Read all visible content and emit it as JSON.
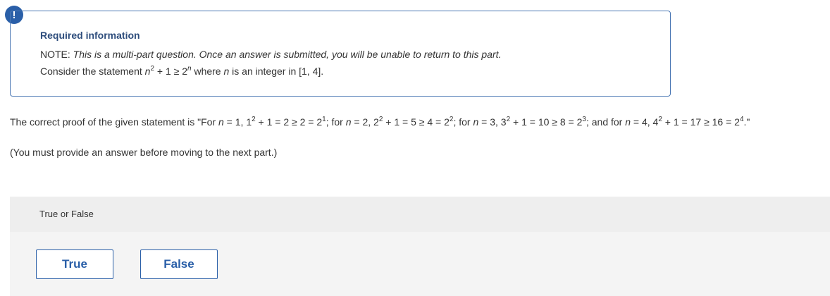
{
  "alert": {
    "glyph": "!"
  },
  "info": {
    "title": "Required information",
    "note_label": "NOTE:",
    "note_text": "This is a multi-part question. Once an answer is submitted, you will be unable to return to this part.",
    "consider_prefix": "Consider the statement",
    "n": "n",
    "exp_2": "2",
    "plus_one_geq_two": "+ 1 ≥ 2",
    "exp_n": "n",
    "where": "where",
    "consider_suffix": "is an integer in [1, 4]."
  },
  "proof": {
    "p0": "The correct proof of the given statement is \"For ",
    "n": "n",
    "s1": " = 1, 1",
    "e1": "2",
    "s2": " + 1 = 2 ≥ 2 = 2",
    "e2": "1",
    "s3": "; for ",
    "s4": " = 2, 2",
    "e3": "2",
    "s5": " + 1 = 5 ≥ 4 = 2",
    "e4": "2",
    "s6": "; for ",
    "s7": " = 3, 3",
    "e5": "2",
    "s8": " + 1 = 10 ≥ 8 = 2",
    "e6": "3",
    "s9": "; and for ",
    "s10": " = 4, 4",
    "e7": "2",
    "s11": " + 1 = 17 ≥ 16 = 2",
    "e8": "4",
    "s12": ".\""
  },
  "instruction": "(You must provide an answer before moving to the next part.)",
  "question": {
    "label": "True or False"
  },
  "choices": {
    "true_label": "True",
    "false_label": "False"
  }
}
